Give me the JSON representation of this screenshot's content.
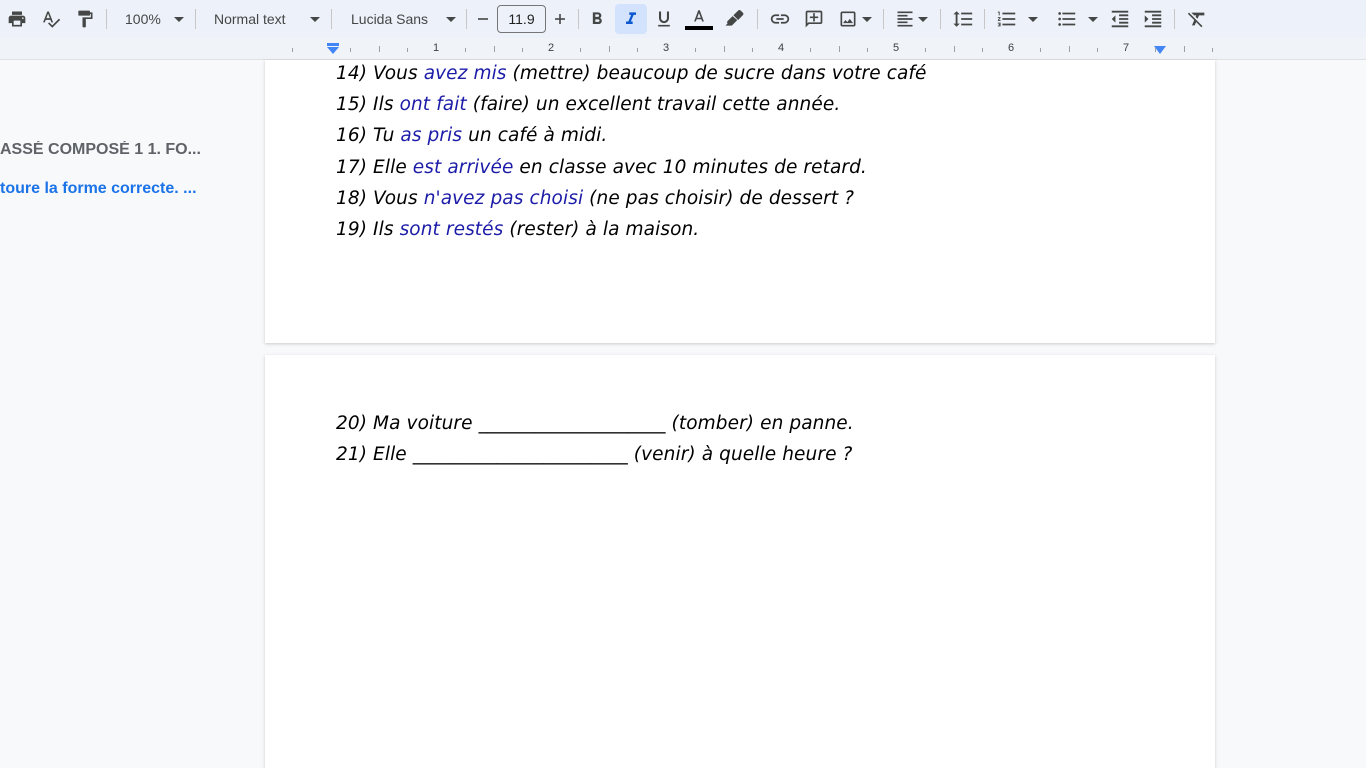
{
  "toolbar": {
    "zoom": "100%",
    "style": "Normal text",
    "font": "Lucida Sans",
    "font_size": "11.9",
    "text_color": "#000000"
  },
  "ruler": {
    "numbers": [
      "1",
      "2",
      "3",
      "4",
      "5",
      "6",
      "7"
    ]
  },
  "outline": {
    "heading": "ASSÉ COMPOSÉ 1 1. FO...",
    "subheading": "toure la forme correcte. ..."
  },
  "page1": {
    "lines": [
      {
        "num": "14) ",
        "pre": "Vous ",
        "answer": "avez mis",
        "post": " (mettre) beaucoup de sucre dans votre café"
      },
      {
        "num": "15) ",
        "pre": "Ils ",
        "answer": "ont fait",
        "post": " (faire) un excellent travail cette année."
      },
      {
        "num": "16) ",
        "pre": "Tu ",
        "answer": "as pris",
        "post": " un café à midi."
      },
      {
        "num": "17) ",
        "pre": "Elle ",
        "answer": "est arrivée",
        "post": " en classe avec 10 minutes de retard."
      },
      {
        "num": "18) ",
        "pre": "Vous ",
        "answer": "n'avez pas choisi",
        "post": " (ne pas choisir) de dessert ?"
      },
      {
        "num": "19) ",
        "pre": "Ils ",
        "answer": "sont restés",
        "post": " (rester) à la maison."
      }
    ]
  },
  "page2": {
    "lines": [
      {
        "text": "20) Ma voiture ____________________ (tomber) en panne."
      },
      {
        "text": "21) Elle _______________________ (venir) à quelle heure ?"
      }
    ]
  },
  "colors": {
    "answer": "#1c1ca8",
    "toolbar_bg": "#edf2fa",
    "outline_link": "#1a73e8"
  }
}
